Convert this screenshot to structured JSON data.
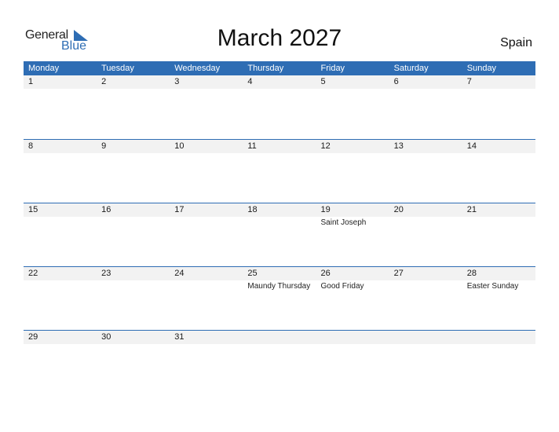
{
  "logo": {
    "text_general": "General",
    "text_blue": "Blue",
    "icon": "triangle-logo-icon"
  },
  "title": "March 2027",
  "country": "Spain",
  "colors": {
    "accent": "#2e6db4",
    "strip": "#f2f2f2"
  },
  "weekdays": [
    "Monday",
    "Tuesday",
    "Wednesday",
    "Thursday",
    "Friday",
    "Saturday",
    "Sunday"
  ],
  "weeks": [
    {
      "days": [
        "1",
        "2",
        "3",
        "4",
        "5",
        "6",
        "7"
      ],
      "holidays": [
        "",
        "",
        "",
        "",
        "",
        "",
        ""
      ]
    },
    {
      "days": [
        "8",
        "9",
        "10",
        "11",
        "12",
        "13",
        "14"
      ],
      "holidays": [
        "",
        "",
        "",
        "",
        "",
        "",
        ""
      ]
    },
    {
      "days": [
        "15",
        "16",
        "17",
        "18",
        "19",
        "20",
        "21"
      ],
      "holidays": [
        "",
        "",
        "",
        "",
        "Saint Joseph",
        "",
        ""
      ]
    },
    {
      "days": [
        "22",
        "23",
        "24",
        "25",
        "26",
        "27",
        "28"
      ],
      "holidays": [
        "",
        "",
        "",
        "Maundy Thursday",
        "Good Friday",
        "",
        "Easter Sunday"
      ]
    },
    {
      "days": [
        "29",
        "30",
        "31",
        "",
        "",
        "",
        ""
      ],
      "holidays": [
        "",
        "",
        "",
        "",
        "",
        "",
        ""
      ]
    }
  ]
}
